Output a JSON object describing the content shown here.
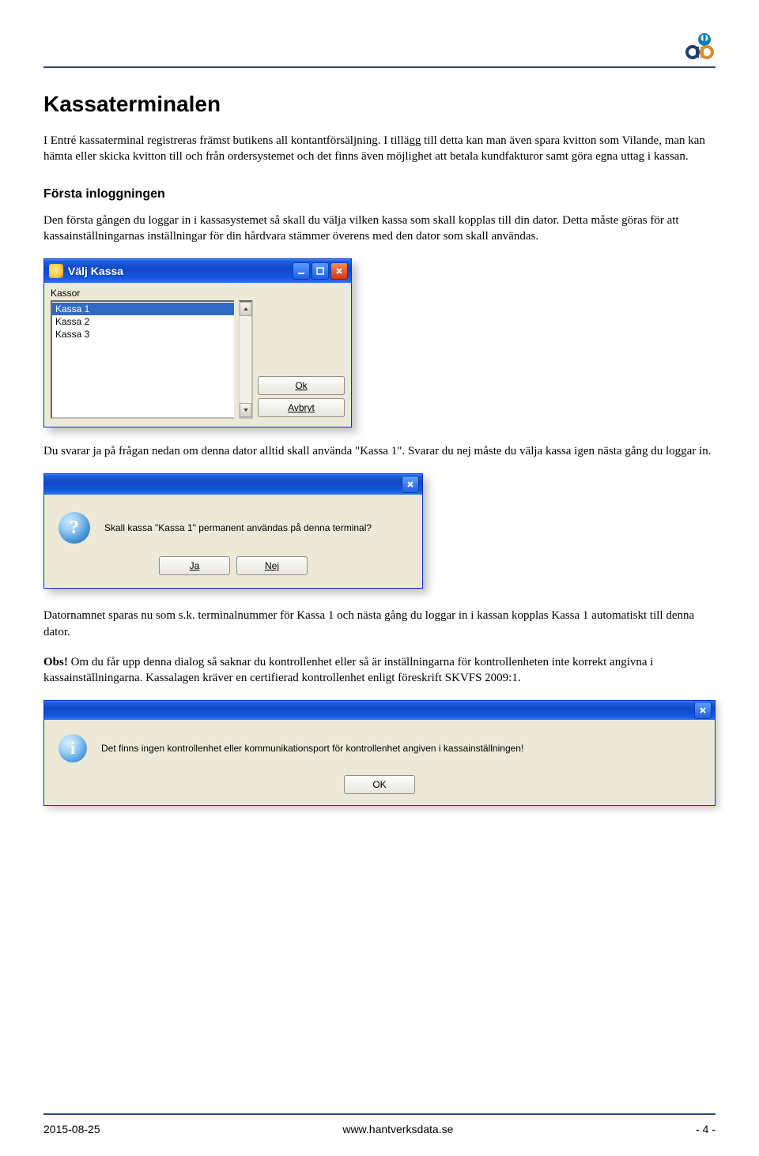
{
  "heading": "Kassaterminalen",
  "para1": "I Entré kassaterminal registreras främst butikens all kontantförsäljning. I tillägg till detta kan man även spara kvitton som Vilande, man kan hämta eller skicka kvitton till och från ordersystemet och det finns även möjlighet att betala kundfakturor samt göra egna uttag i kassan.",
  "subhead1": "Första inloggningen",
  "para2": "Den första gången du loggar in i kassasystemet så skall du välja vilken kassa som skall kopplas till din dator. Detta måste göras för att kassainställningarnas inställningar för din hårdvara stämmer överens med den dator som skall användas.",
  "valj_kassa": {
    "title": "Välj Kassa",
    "group_label": "Kassor",
    "items": [
      "Kassa 1",
      "Kassa 2",
      "Kassa 3"
    ],
    "ok": "Ok",
    "avbryt": "Avbryt"
  },
  "para3": "Du svarar ja på frågan nedan om denna dator alltid skall använda \"Kassa 1\". Svarar du nej måste du välja kassa igen nästa gång du loggar in.",
  "confirm": {
    "message": "Skall kassa \"Kassa 1\" permanent användas på denna terminal?",
    "ja": "Ja",
    "nej": "Nej"
  },
  "para4": "Datornamnet sparas nu som s.k. terminalnummer för Kassa 1 och nästa gång du loggar in i kassan kopplas Kassa 1 automatiskt till denna dator.",
  "para5_prefix": "Obs!",
  "para5": " Om du får upp denna dialog så saknar du kontrollenhet eller så är inställningarna för kontrollenheten inte korrekt angivna i kassainställningarna. Kassalagen kräver en certifierad kontrollenhet enligt föreskrift SKVFS 2009:1.",
  "info": {
    "message": "Det finns ingen kontrollenhet eller kommunikationsport för kontrollenhet angiven i kassainställningen!",
    "ok": "OK"
  },
  "footer": {
    "date": "2015-08-25",
    "url": "www.hantverksdata.se",
    "page": "- 4 -"
  }
}
